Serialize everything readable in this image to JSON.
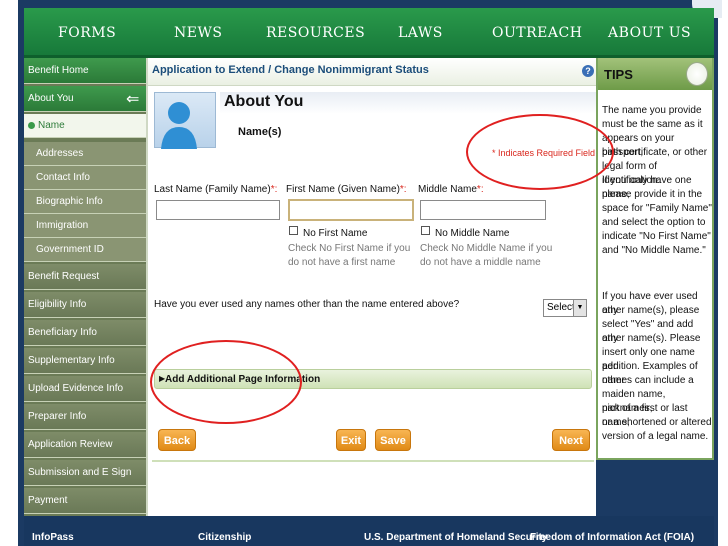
{
  "topnav": {
    "items": [
      {
        "label": "FORMS"
      },
      {
        "label": "NEWS"
      },
      {
        "label": "RESOURCES"
      },
      {
        "label": "LAWS"
      },
      {
        "label": "OUTREACH"
      },
      {
        "label": "ABOUT US"
      }
    ]
  },
  "sidebar": {
    "items": [
      {
        "label": "Benefit Home"
      },
      {
        "label": "About You"
      },
      {
        "label": "Name"
      },
      {
        "label": "Addresses"
      },
      {
        "label": "Contact Info"
      },
      {
        "label": "Biographic Info"
      },
      {
        "label": "Immigration"
      },
      {
        "label": "Government ID"
      },
      {
        "label": "Benefit Request"
      },
      {
        "label": "Eligibility Info"
      },
      {
        "label": "Beneficiary Info"
      },
      {
        "label": "Supplementary Info"
      },
      {
        "label": "Upload Evidence Info"
      },
      {
        "label": "Preparer Info"
      },
      {
        "label": "Application Review"
      },
      {
        "label": "Submission and E Sign"
      },
      {
        "label": "Payment"
      }
    ]
  },
  "main": {
    "app_title": "Application to Extend / Change Nonimmigrant Status",
    "help_glyph": "?",
    "section_title": "About You",
    "subhead": "Name(s)",
    "required_note": "* Indicates Required Field",
    "fields": {
      "last_name_label": "Last Name (Family Name)",
      "first_name_label": "First Name (Given Name)",
      "middle_name_label": "Middle Name",
      "required_mark": "*:",
      "last_name_value": "",
      "first_name_value": "",
      "middle_name_value": ""
    },
    "no_first": {
      "label": "No First Name",
      "hint_1": "Check No First Name if you",
      "hint_2": "do not have a first name"
    },
    "no_middle": {
      "label": "No Middle Name",
      "hint_1": "Check No Middle Name if you",
      "hint_2": "do not have a middle name"
    },
    "question": "Have you ever used any names other than the name entered above?",
    "select_value": "Select",
    "additional": "Add Additional Page Information",
    "buttons": {
      "back": "Back",
      "exit": "Exit",
      "save": "Save",
      "next": "Next"
    }
  },
  "tips": {
    "title": "TIPS",
    "paragraph_1": [
      "The name you provide",
      "must be the same as it",
      "appears on your passport,",
      "birth certificate, or other",
      "legal form of identification.",
      "If you only have one name,",
      "please provide it in the",
      "space for \"Family Name\"",
      "and select the option to",
      "indicate \"No First Name\"",
      "and \"No Middle Name.\""
    ],
    "paragraph_2": [
      "If you have ever used any",
      "other name(s), please",
      "select \"Yes\" and add any",
      "other name(s). Please",
      "insert only one name per",
      "addition. Examples of other",
      "names can include a",
      "maiden name, nicknames,",
      "part of a first or last name,",
      "or a shortened or altered",
      "version of a legal name."
    ]
  },
  "footer": {
    "items": [
      {
        "label": "InfoPass"
      },
      {
        "label": "Citizenship"
      },
      {
        "label": "U.S. Department of Homeland Security"
      },
      {
        "label": "Freedom of Information Act (FOIA)"
      }
    ]
  },
  "colors": {
    "nav_green": "#17793a",
    "annotation_red": "#e02020",
    "button_orange": "#e08a16",
    "footer_navy": "#18375f"
  }
}
